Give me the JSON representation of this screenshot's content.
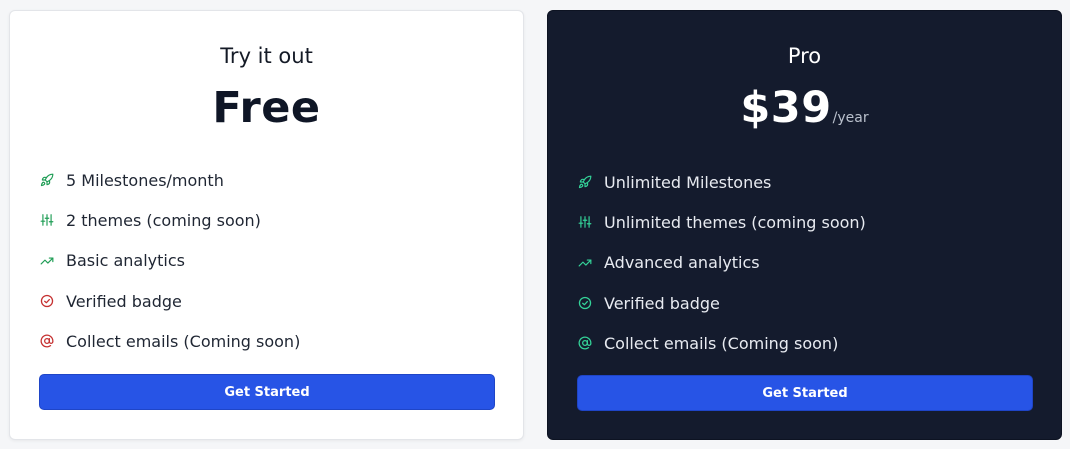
{
  "colors": {
    "accent_green": "#1f9d55",
    "accent_red": "#c53030",
    "pro_green": "#34d399",
    "button_blue": "#2754e6",
    "dark_bg": "#141b2d"
  },
  "free": {
    "title": "Try it out",
    "price": "Free",
    "features": [
      {
        "icon": "rocket-icon",
        "text": "5 Milestones/month"
      },
      {
        "icon": "sliders-icon",
        "text": "2 themes (coming soon)"
      },
      {
        "icon": "trending-up-icon",
        "text": "Basic analytics"
      },
      {
        "icon": "check-circle-icon",
        "text": "Verified badge"
      },
      {
        "icon": "at-sign-icon",
        "text": "Collect emails (Coming soon)"
      }
    ],
    "button_label": "Get Started"
  },
  "pro": {
    "title": "Pro",
    "price": "$39",
    "period": "/year",
    "features": [
      {
        "icon": "rocket-icon",
        "text": "Unlimited Milestones"
      },
      {
        "icon": "sliders-icon",
        "text": "Unlimited themes (coming soon)"
      },
      {
        "icon": "trending-up-icon",
        "text": "Advanced analytics"
      },
      {
        "icon": "check-circle-icon",
        "text": "Verified badge"
      },
      {
        "icon": "at-sign-icon",
        "text": "Collect emails (Coming soon)"
      }
    ],
    "button_label": "Get Started"
  }
}
